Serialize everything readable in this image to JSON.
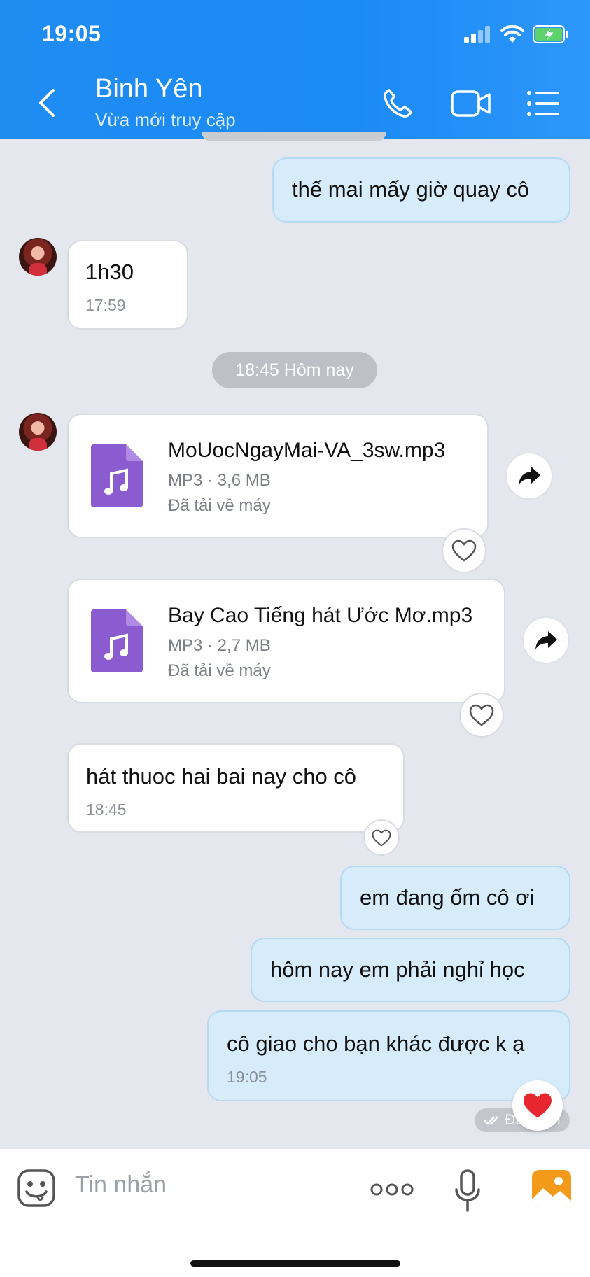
{
  "status_bar": {
    "time": "19:05"
  },
  "header": {
    "contact_name": "Binh Yên",
    "contact_status": "Vừa mới truy cập",
    "icons": [
      "back-arrow-icon",
      "phone-icon",
      "video-call-icon",
      "menu-list-icon"
    ]
  },
  "messages": {
    "m1": {
      "text": "thế mai mấy giờ quay cô"
    },
    "m2": {
      "text": "1h30",
      "time": "17:59"
    },
    "date_separator": "18:45 Hôm nay",
    "file1": {
      "name": "MoUocNgayMai-VA_3sw.mp3",
      "meta": "MP3 · 3,6 MB",
      "status": "Đã tải về máy"
    },
    "file2": {
      "name": "Bay Cao Tiếng hát Ước Mơ.mp3",
      "meta": "MP3 · 2,7 MB",
      "status": "Đã tải về máy"
    },
    "m3": {
      "text": "hát thuoc hai bai nay cho cô",
      "time": "18:45"
    },
    "m4": {
      "text": "em đang ốm cô ơi"
    },
    "m5": {
      "text": "hôm nay em phải nghỉ học"
    },
    "m6": {
      "text": "cô giao cho bạn khác được k ạ",
      "time": "19:05"
    },
    "seen_label": "Đã nhận"
  },
  "input": {
    "placeholder": "Tin nhắn",
    "more_label": "ooo"
  },
  "colors": {
    "header_blue": "#1a8af5",
    "outgoing_bubble": "#d6ecfb",
    "file_icon_purple": "#8b5bd0",
    "heart_red": "#e8262f"
  }
}
